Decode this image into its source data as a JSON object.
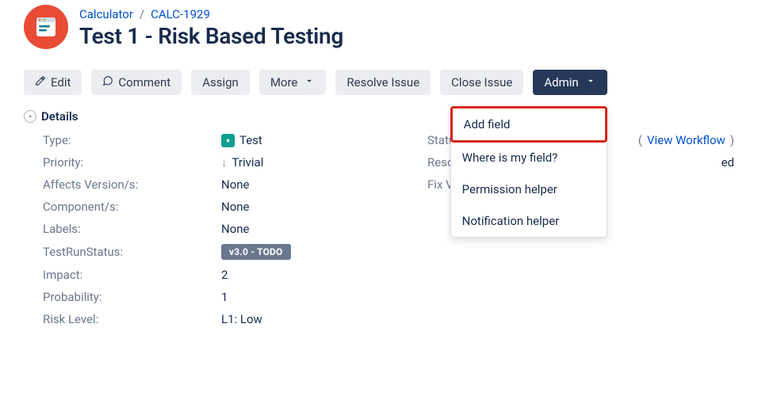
{
  "breadcrumb": {
    "project": "Calculator",
    "sep": "/",
    "issue_key": "CALC-1929"
  },
  "issue_title": "Test 1 - Risk Based Testing",
  "toolbar": {
    "edit": "Edit",
    "comment": "Comment",
    "assign": "Assign",
    "more": "More",
    "resolve": "Resolve Issue",
    "close": "Close Issue",
    "admin": "Admin"
  },
  "admin_menu": {
    "add_field": "Add field",
    "where_is_my_field": "Where is my field?",
    "permission_helper": "Permission helper",
    "notification_helper": "Notification helper"
  },
  "section_title": "Details",
  "view_workflow": "View Workflow",
  "left_details": {
    "type_label": "Type:",
    "type_value": "Test",
    "priority_label": "Priority:",
    "priority_value": "Trivial",
    "affects_label": "Affects Version/s:",
    "affects_value": "None",
    "components_label": "Component/s:",
    "components_value": "None",
    "labels_label": "Labels:",
    "labels_value": "None",
    "testrun_label": "TestRunStatus:",
    "testrun_value": "v3.0 - TODO",
    "impact_label": "Impact:",
    "impact_value": "2",
    "probability_label": "Probability:",
    "probability_value": "1",
    "risk_label": "Risk Level:",
    "risk_value": "L1: Low"
  },
  "right_details": {
    "status_label": "Status:",
    "resolution_label": "Resolution:",
    "resolution_value_fragment": "ed",
    "fixversions_label": "Fix Version/s:"
  }
}
